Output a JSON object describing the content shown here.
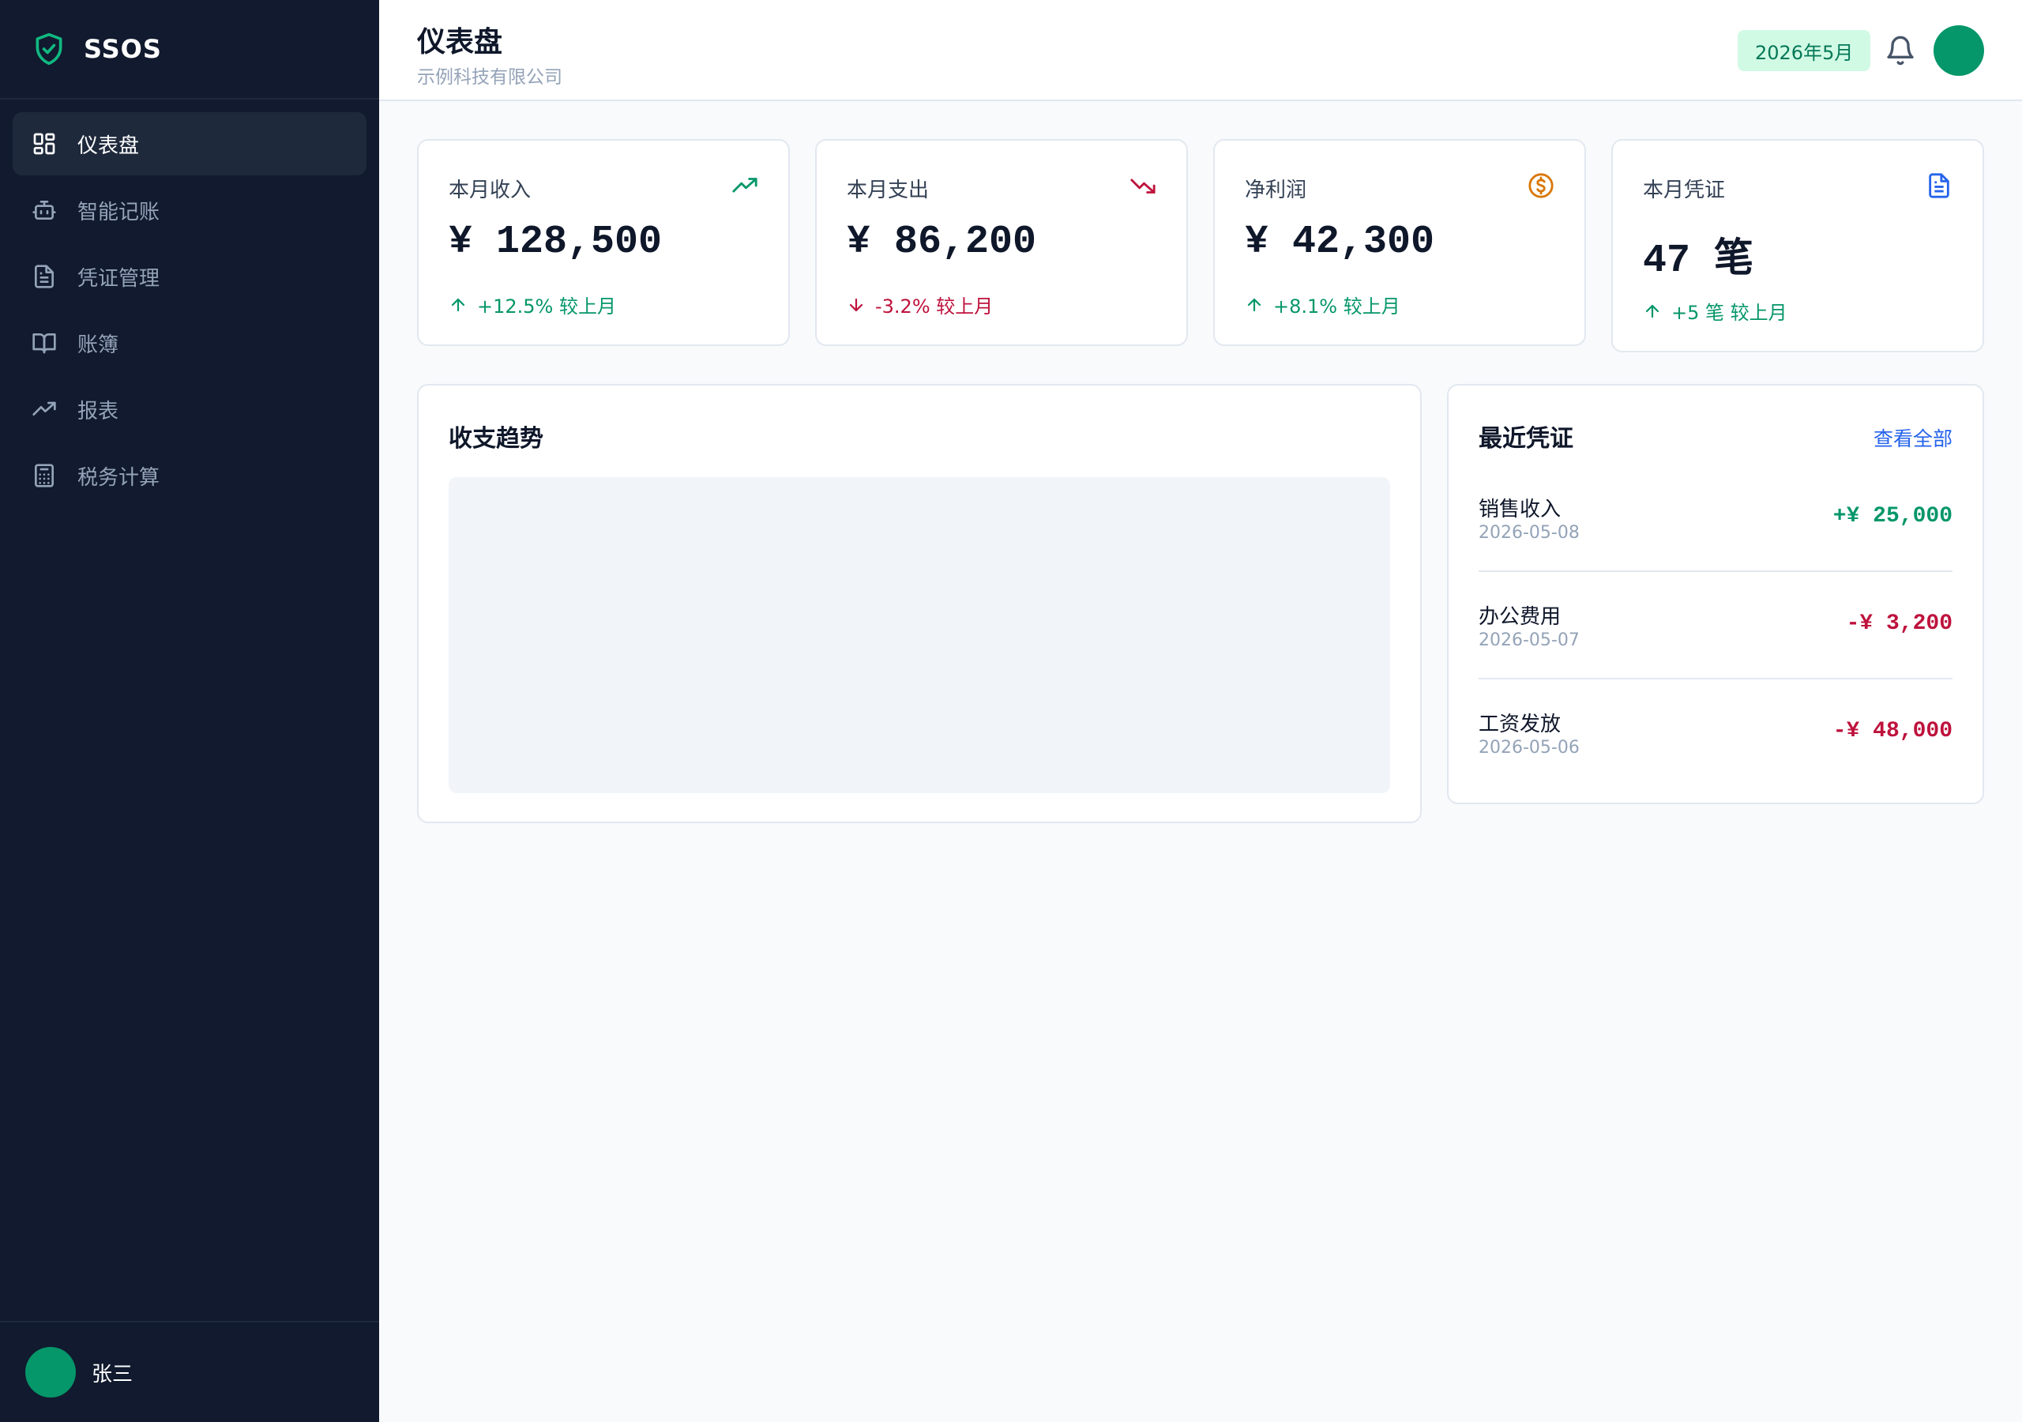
{
  "brand": {
    "name": "SSOS",
    "icon": "shield-check-icon"
  },
  "sidebar": {
    "items": [
      {
        "label": "仪表盘",
        "icon": "dashboard-icon",
        "active": true
      },
      {
        "label": "智能记账",
        "icon": "bot-icon",
        "active": false
      },
      {
        "label": "凭证管理",
        "icon": "document-icon",
        "active": false
      },
      {
        "label": "账簿",
        "icon": "book-icon",
        "active": false
      },
      {
        "label": "报表",
        "icon": "trend-icon",
        "active": false
      },
      {
        "label": "税务计算",
        "icon": "calculator-icon",
        "active": false
      }
    ]
  },
  "user": {
    "name": "张三"
  },
  "header": {
    "title": "仪表盘",
    "company": "示例科技有限公司",
    "period": "2026年5月"
  },
  "stats": [
    {
      "label": "本月收入",
      "value": "¥ 128,500",
      "change": "+12.5% 较上月",
      "direction": "up",
      "icon": "trending-up-icon"
    },
    {
      "label": "本月支出",
      "value": "¥ 86,200",
      "change": "-3.2% 较上月",
      "direction": "down",
      "icon": "trending-down-icon"
    },
    {
      "label": "净利润",
      "value": "¥ 42,300",
      "change": "+8.1% 较上月",
      "direction": "up",
      "icon": "dollar-circle-icon"
    },
    {
      "label": "本月凭证",
      "value": "47 笔",
      "change": "+5 笔 较上月",
      "direction": "up",
      "icon": "file-text-icon"
    }
  ],
  "chart": {
    "title": "收支趋势"
  },
  "recent": {
    "title": "最近凭证",
    "view_all": "查看全部",
    "items": [
      {
        "name": "销售收入",
        "date": "2026-05-08",
        "amount": "+¥ 25,000",
        "type": "income"
      },
      {
        "name": "办公费用",
        "date": "2026-05-07",
        "amount": "-¥ 3,200",
        "type": "expense"
      },
      {
        "name": "工资发放",
        "date": "2026-05-06",
        "amount": "-¥ 48,000",
        "type": "expense"
      }
    ]
  },
  "colors": {
    "sidebar_bg": "#111a2e",
    "accent": "#059669",
    "negative": "#be123c",
    "link": "#2563eb"
  }
}
